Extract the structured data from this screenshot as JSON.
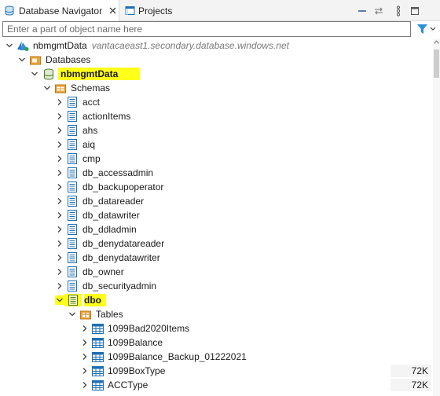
{
  "tabs": [
    {
      "label": "Database Navigator",
      "active": true,
      "icon": "database-navigator-icon"
    },
    {
      "label": "Projects",
      "active": false,
      "icon": "projects-icon"
    }
  ],
  "toolbar": [
    "minimize-icon",
    "link-with-editor-icon",
    "view-menu-icon",
    "maximize-icon"
  ],
  "filter": {
    "placeholder": "Enter a part of object name here",
    "value": ""
  },
  "tree": {
    "connection": {
      "label": "nbmgmtData",
      "host": "vantacaeast1.secondary.database.windows.net"
    },
    "databases_label": "Databases",
    "database": {
      "label": "nbmgmtData",
      "highlighted": true
    },
    "schemas_label": "Schemas",
    "schemas": [
      "acct",
      "actionItems",
      "ahs",
      "aiq",
      "cmp",
      "db_accessadmin",
      "db_backupoperator",
      "db_datareader",
      "db_datawriter",
      "db_ddladmin",
      "db_denydatareader",
      "db_denydatawriter",
      "db_owner",
      "db_securityadmin"
    ],
    "expanded_schema": {
      "label": "dbo",
      "highlighted": true
    },
    "tables_label": "Tables",
    "tables": [
      {
        "name": "1099Bad2020Items",
        "size": ""
      },
      {
        "name": "1099Balance",
        "size": ""
      },
      {
        "name": "1099Balance_Backup_01222021",
        "size": ""
      },
      {
        "name": "1099BoxType",
        "size": "72K"
      },
      {
        "name": "ACCType",
        "size": "72K"
      }
    ]
  },
  "colors": {
    "highlight": "#ffff1a",
    "accent": "#1f6fb5",
    "folder": "#e7a33e"
  }
}
